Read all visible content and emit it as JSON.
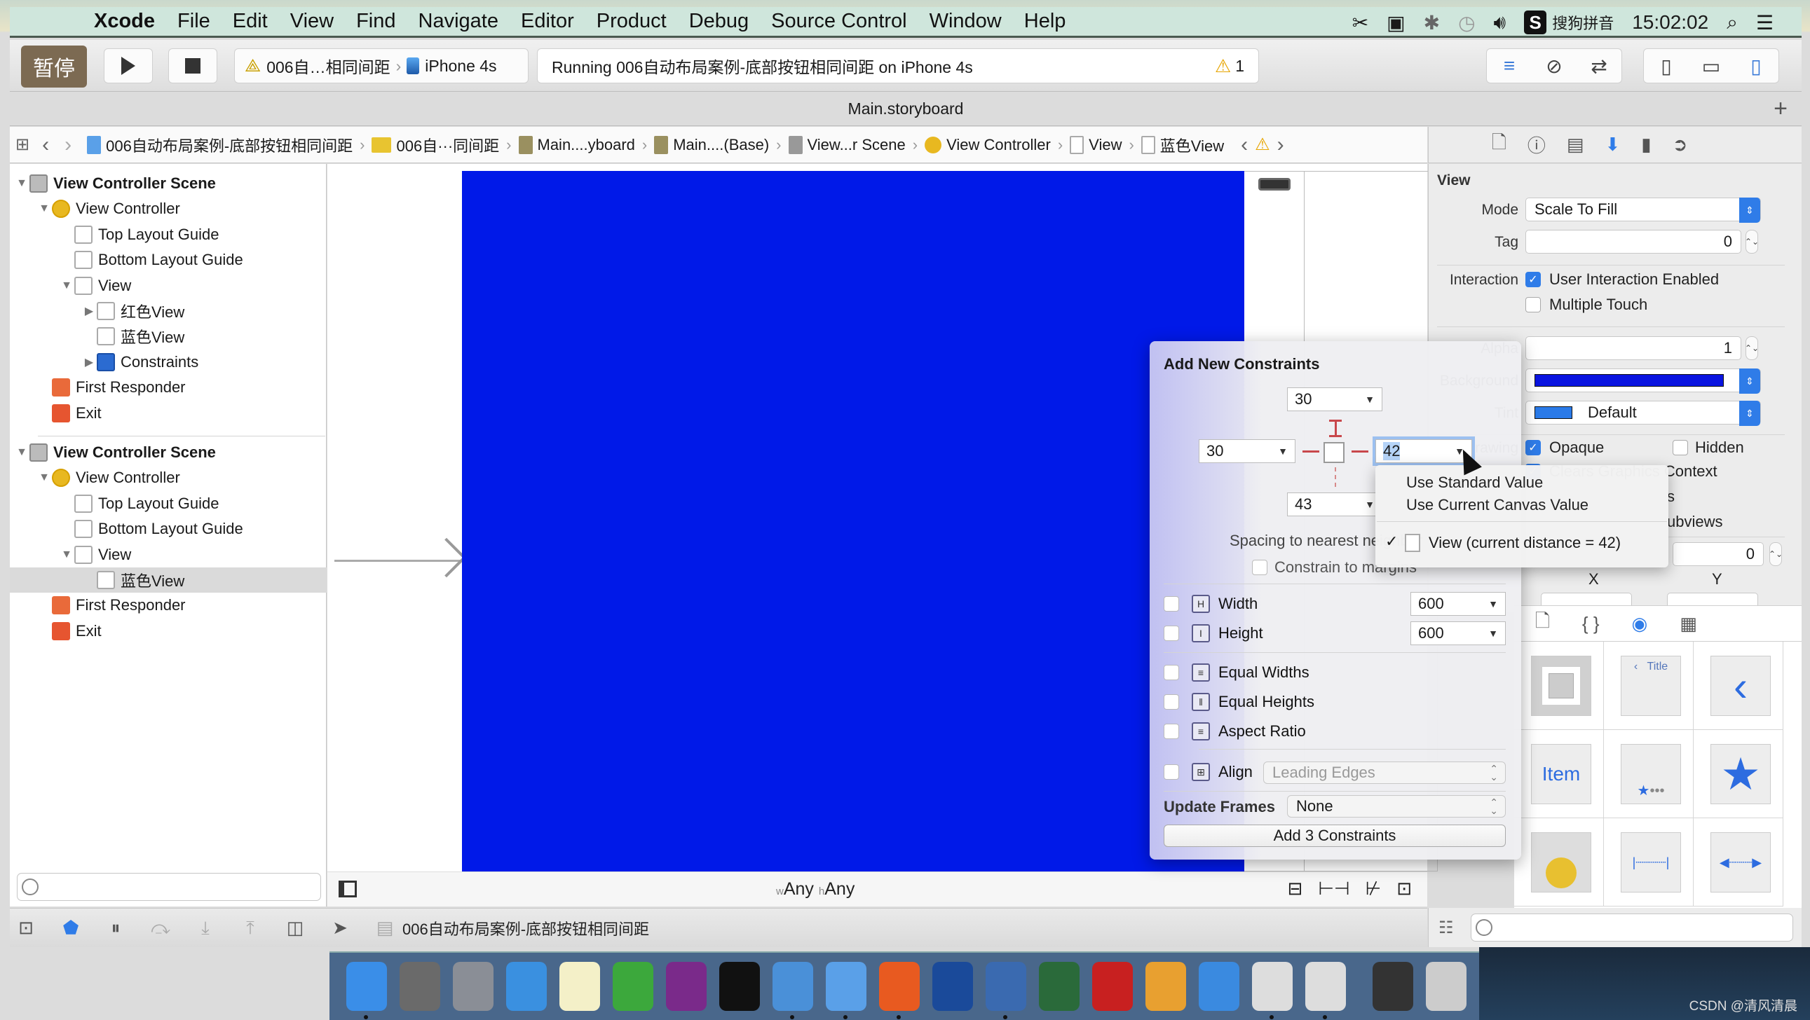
{
  "overlay": {
    "pause_label": "暂停"
  },
  "menubar": {
    "apple": "",
    "items": [
      "Xcode",
      "File",
      "Edit",
      "View",
      "Find",
      "Navigate",
      "Editor",
      "Product",
      "Debug",
      "Source Control",
      "Window",
      "Help"
    ],
    "status": {
      "input_method_badge": "S",
      "input_method": "搜狗拼音",
      "clock": "15:02:02"
    }
  },
  "toolbar": {
    "scheme": {
      "target": "006自…相同间距",
      "device": "iPhone 4s"
    },
    "activity": {
      "text": "Running 006自动布局案例-底部按钮相同间距 on iPhone 4s",
      "warning_count": "1"
    }
  },
  "tabbar": {
    "title": "Main.storyboard",
    "add": "+"
  },
  "jumpbar": {
    "items": [
      "006自动布局案例-底部按钮相同间距",
      "006自···同间距",
      "Main....yboard",
      "Main....(Base)",
      "View...r Scene",
      "View Controller",
      "View",
      "蓝色View"
    ]
  },
  "navigator": {
    "outline1": [
      {
        "label": "View Controller Scene",
        "icon": "scene",
        "depth": 0,
        "disclosure": "open",
        "bold": true
      },
      {
        "label": "View Controller",
        "icon": "vc",
        "depth": 1,
        "disclosure": "open"
      },
      {
        "label": "Top Layout Guide",
        "icon": "box",
        "depth": 2
      },
      {
        "label": "Bottom Layout Guide",
        "icon": "box",
        "depth": 2
      },
      {
        "label": "View",
        "icon": "box",
        "depth": 2,
        "disclosure": "open"
      },
      {
        "label": "红色View",
        "icon": "box",
        "depth": 3,
        "disclosure": "closed"
      },
      {
        "label": "蓝色View",
        "icon": "box",
        "depth": 3
      },
      {
        "label": "Constraints",
        "icon": "cons",
        "depth": 3,
        "disclosure": "closed"
      },
      {
        "label": "First Responder",
        "icon": "fr",
        "depth": 1
      },
      {
        "label": "Exit",
        "icon": "exit",
        "depth": 1
      }
    ],
    "outline2": [
      {
        "label": "View Controller Scene",
        "icon": "scene",
        "depth": 0,
        "disclosure": "open",
        "bold": true
      },
      {
        "label": "View Controller",
        "icon": "vc",
        "depth": 1,
        "disclosure": "open"
      },
      {
        "label": "Top Layout Guide",
        "icon": "box",
        "depth": 2
      },
      {
        "label": "Bottom Layout Guide",
        "icon": "box",
        "depth": 2
      },
      {
        "label": "View",
        "icon": "box",
        "depth": 2,
        "disclosure": "open"
      },
      {
        "label": "蓝色View",
        "icon": "box",
        "depth": 3,
        "selected": true
      },
      {
        "label": "First Responder",
        "icon": "fr",
        "depth": 1
      },
      {
        "label": "Exit",
        "icon": "exit",
        "depth": 1
      }
    ],
    "filter_placeholder": ""
  },
  "canvas": {
    "size_class": {
      "w_prefix": "w",
      "w": "Any",
      "h_prefix": "h",
      "h": "Any"
    },
    "view_color": "#0019e8"
  },
  "inspector": {
    "section": "View",
    "mode_label": "Mode",
    "mode_value": "Scale To Fill",
    "tag_label": "Tag",
    "tag_value": "0",
    "interaction_label": "Interaction",
    "user_interaction": {
      "label": "User Interaction Enabled",
      "checked": true
    },
    "multiple_touch": {
      "label": "Multiple Touch",
      "checked": false
    },
    "alpha_label": "Alpha",
    "alpha_value": "1",
    "background_label": "Background",
    "background_color": "#0a14e0",
    "tint_label": "Tint",
    "tint_value": "Default",
    "tint_color": "#2a7ae8",
    "drawing_label": "Drawing",
    "opaque": {
      "label": "Opaque",
      "checked": true
    },
    "hidden": {
      "label": "Hidden",
      "checked": false
    },
    "clears_graphics": {
      "label": "Clears Graphics Context",
      "checked": true
    },
    "clip_subviews_partial": "s",
    "autoresize_partial": "ubviews",
    "stretch_y_value": "0",
    "x_label": "X",
    "y_label": "Y"
  },
  "popover": {
    "title": "Add New Constraints",
    "top": "30",
    "left": "30",
    "right": "42",
    "bottom": "43",
    "spacing_label": "Spacing to nearest neighbor",
    "constrain_margins": {
      "label": "Constrain to margins",
      "checked": false
    },
    "width": {
      "label": "Width",
      "value": "600",
      "checked": false
    },
    "height": {
      "label": "Height",
      "value": "600",
      "checked": false
    },
    "equal_widths": {
      "label": "Equal Widths",
      "checked": false
    },
    "equal_heights": {
      "label": "Equal Heights",
      "checked": false
    },
    "aspect_ratio": {
      "label": "Aspect Ratio",
      "checked": false
    },
    "align": {
      "label": "Align",
      "value": "Leading Edges",
      "checked": false
    },
    "update_frames_label": "Update Frames",
    "update_frames_value": "None",
    "add_button": "Add 3 Constraints"
  },
  "dropdown": {
    "items": [
      "Use Standard Value",
      "Use Current Canvas Value"
    ],
    "checked_item": "View (current distance = 42)"
  },
  "library": {
    "items": [
      "view",
      "navigation-bar",
      "back-button",
      "Item",
      "tab-bar",
      "star-item",
      "search-bar",
      "fixed-space",
      "flexible-space"
    ],
    "item_label": "Item",
    "title_label": "Title"
  },
  "debugbar": {
    "project": "006自动布局案例-底部按钮相同间距"
  },
  "dock": {
    "apps": [
      "Finder",
      "System Preferences",
      "Launchpad",
      "Safari",
      "Notes",
      "Excel",
      "OneNote",
      "Terminal",
      "Xcode",
      "Simulator",
      "PowerPoint",
      "Screenshot",
      "Photo Slideshow",
      "Installer",
      "FileZilla",
      "Pages Tools",
      "Word",
      "Instruments 1",
      "Instruments 2",
      "Screen Sharing",
      "Trash"
    ]
  },
  "watermark": "CSDN @清风清晨"
}
